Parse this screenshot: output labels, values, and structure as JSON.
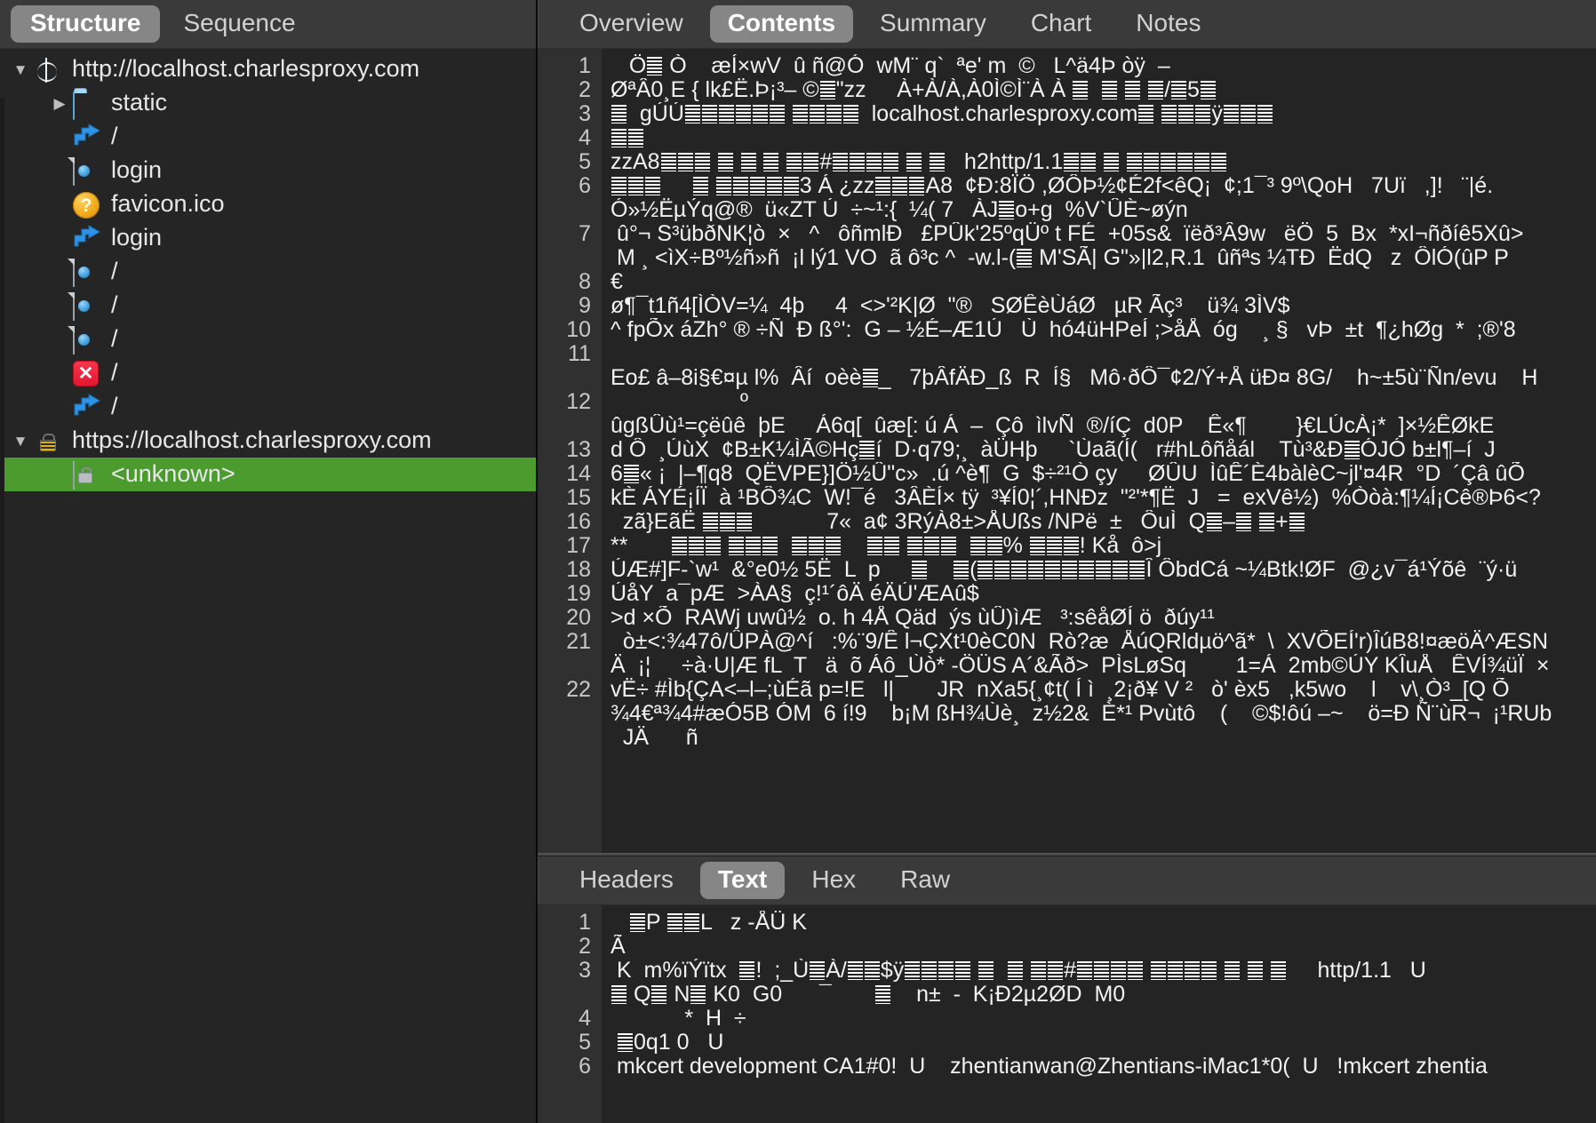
{
  "sidebar": {
    "tabs": [
      {
        "label": "Structure",
        "active": true
      },
      {
        "label": "Sequence",
        "active": false
      }
    ],
    "tree": [
      {
        "label": "http://localhost.charlesproxy.com",
        "icon": "globe-icon",
        "twisty": "open",
        "indent": 1,
        "selected": false
      },
      {
        "label": "static",
        "icon": "folder-icon",
        "twisty": "closed",
        "indent": 2,
        "selected": false
      },
      {
        "label": "/",
        "icon": "redirect-icon",
        "twisty": "blank",
        "indent": 2,
        "selected": false
      },
      {
        "label": "login",
        "icon": "document-icon",
        "twisty": "blank",
        "indent": 2,
        "selected": false
      },
      {
        "label": "favicon.ico",
        "icon": "question-icon",
        "twisty": "blank",
        "indent": 2,
        "selected": false
      },
      {
        "label": "login",
        "icon": "redirect-icon",
        "twisty": "blank",
        "indent": 2,
        "selected": false
      },
      {
        "label": "/",
        "icon": "document-icon",
        "twisty": "blank",
        "indent": 2,
        "selected": false
      },
      {
        "label": "/",
        "icon": "document-icon",
        "twisty": "blank",
        "indent": 2,
        "selected": false
      },
      {
        "label": "/",
        "icon": "document-icon",
        "twisty": "blank",
        "indent": 2,
        "selected": false
      },
      {
        "label": "/",
        "icon": "error-icon",
        "twisty": "blank",
        "indent": 2,
        "selected": false
      },
      {
        "label": "/",
        "icon": "redirect-icon",
        "twisty": "blank",
        "indent": 2,
        "selected": false
      },
      {
        "label": "https://localhost.charlesproxy.com",
        "icon": "lock-icon",
        "twisty": "open",
        "indent": 1,
        "selected": false
      },
      {
        "label": "<unknown>",
        "icon": "doc-lock-icon",
        "twisty": "blank",
        "indent": 2,
        "selected": true
      }
    ],
    "selected_color": "#4b9b2f"
  },
  "main_pane": {
    "tabs": [
      {
        "label": "Overview",
        "active": false
      },
      {
        "label": "Contents",
        "active": true
      },
      {
        "label": "Summary",
        "active": false
      },
      {
        "label": "Chart",
        "active": false
      },
      {
        "label": "Notes",
        "active": false
      }
    ],
    "line_numbers": [
      "1",
      "2",
      "3",
      "4",
      "5",
      "6",
      "",
      "7",
      "",
      "8",
      "9",
      "10",
      "11",
      "",
      "12",
      "",
      "13",
      "14",
      "15",
      "16",
      "17",
      "18",
      "19",
      "20",
      "21",
      "",
      "22",
      ""
    ],
    "lines": [
      "   Ö█ Ò    æÍ×wV  û ñ@Ó  wM¨ q`  ªe' m  ©   L^ä4Þ òÿ  –",
      "ØªÂ0¸E { lk£Ë.Þ¡³– ©█\"zz     À+À/À,À0Ì©Ì¨À À █  █ █ █/█5█",
      "█  gÚÚ██████ ████  localhost.charlesproxy.com█ ███ÿ███",
      "██",
      "zzA8███ █ █ █ ██#████ █ █   h2http/1.1██ █ ██████",
      "███     █ █████3 Á ¿zz███A8  ¢Ð:8ÏÖ ,ØÔÞ½¢É2f<êQ¡  ¢;1¯³ 9º\\QoH   7Uï   ,]!   ¨|é.",
      "Ó»½ËµÝq@®  ü«ZT Ú  ÷~¹:{  ¼( 7   ÀJ█o+g  %V`ÛÈ~øýn",
      " û°¬ S³übðNK¦ò  ×   ^   ôñmlÐ   £PÛk'25ºqÜº t FÉ  +05s&  ïëð³Â9w   ëÖ  5  Bx  *xI¬ñðíê5Xû>",
      " M ¸ <ìX÷Bº½ñ»ñ  ¡l lý1 VO  ã ô³c ^  -w.l-(█ M'SÃ| G\"»|l2,R.1  ûñªs ¼TÐ  ËdQ   z  ÔlÓ(ûP P",
      "€",
      "ø¶¯t1ñ4[ÌÒV=¼  4þ     4  <>'²K|Ø  \"®   SØÊèÙáØ   µR Ãç³    ü¾ 3ÌV$",
      "^ fpÕx áZh° ® ÷Ñ  Ð ß°':  G – ½É–Æ1Ú   Ù  hó4üHPeÍ ;>åÅ  óg    ¸ §   vÞ  ±t  ¶¿hØg  *  ;®'8",
      "",
      "Eo£ â–8i§€¤µ l%  Âí  oèè█_   7þÂfÄÐ_ß  R  Í§   Mô·ðÔ¯¢2/Ý+Å üÐ¤ 8G/    h~±5ù¨Ñn/evu    H",
      "                     º",
      "ûgßÛù¹=çëûê  þE     Á6q[  ûæ[: ú Á  –  Çô  ìlvÑ  ®/íÇ  d0P    Ê«¶        }€LÚcÀ¡*  ]×½ÊØkE",
      "d Ô  ¸ÚùX  ¢B±K¼ÌÃ©Hç█í  D·q79;¸  àÜHþ     `Ùaã(Í(   r#hLôñåál    Tù³&Ð█ÓJÓ b±l¶–í  J",
      "6█« ¡  |–¶q8  QËVPE}]Ö½Û\"c»  .ú ^è¶  G  $÷²¹Ò çy     ØÛU  ÌûÊ´È4bàlèC~jl'¤4R  °D  ´Çâ ûÕ",
      "kÈ ÁYÉ¡ÍÏ  à ¹BÔ¾C  W!¯é   3ÂÈÍ× tÿ  ³¥Í0¦´,HNÐz  \"²'*¶Ë  J   =  exVê½)  %Òòà:¶¼Í¡Cê®Þ6<?  ",
      "  zã}EãË ███            7«  a¢ 3RýÀ8±>ÅUßs /NPë  ±   ÔuÌ  Q█–█ █+█",
      "**       ███ ███  ███    ██ ███  ██% ███! Kå  ô>j",
      "ÚÆ#]F-`w¹  &°e0½ 5Ë  L  p     █    █(██████████Î ÔbdCá ~¼Btk!ØF  @¿v¯á¹Ýõê  ¨ý·ü",
      "ÚåY  a¯pÆ  >ÀA§  ç!¹´ôÄ éÄÚ'ÆAû$",
      ">d ×Õ  RAWj uwû½  o. h 4Å Qäd  ýs ùÛ)ìÆ   ³:sêåØÍ ö  ðúy¹¹",
      "  ò±<:¾47ô/ÛPÀ@^í   :%¨9/Ê l¬ÇXt¹0èC0N  Rò?æ  ÅúQRldµö^ã*  \\  XVÕEÍ'r)ÎúB8!¤æöÄ^ÆSN",
      "Ä  ¡¦     ÷à·U|Æ fL  T   ä  õ Áô_Ùò* -ÖÜS A´&Ãð>  PÌsLøSq        1=Á  2mb©ÚY KÎuÅ   ÊVÍ¾üÏ  ×",
      "vË÷ #Ìb{ÇA<–l–;ùÉã p=!E   l|       JR  nXa5{¸¢t( Í ì  ¸2¡ð¥ V ²   ò' èx5   ,k5wo    l    v\\¸Ò³_[Q Õ",
      "¾4€ª¾4#æÓ5B ÓM  6 í!9    b¡M ßH¾Ùè¸  z½2&  È*¹ Pvùtô    (    ©$!ôú –~    ö=Ð Ñ¨ùR¬  ¡¹RUb",
      "  JÄ      ñ"
    ]
  },
  "bottom_pane": {
    "tabs": [
      {
        "label": "Headers",
        "active": false
      },
      {
        "label": "Text",
        "active": true
      },
      {
        "label": "Hex",
        "active": false
      },
      {
        "label": "Raw",
        "active": false
      }
    ],
    "line_numbers": [
      "1",
      "2",
      "3",
      "",
      "4",
      "5",
      "6"
    ],
    "lines": [
      "   █P ██L   z -ÅÜ K",
      "Ã",
      " K  m%ïÝïtx  █!  ;_Ù█À/██$ÿ████ █  █ ██#████ ████ █ █ █     http/1.1   U",
      "█ Q█ N█ K0  G0      ¯       █    n±  -  K¡Ð2µ2ØD  M0",
      "            *  H  ÷",
      " █0q1 0   U",
      " mkcert development CA1#0!  U    zhentianwan@Zhentians-iMac1*0(  U   !mkcert zhentia"
    ]
  },
  "colors": {
    "window_bg": "#242424",
    "tabbar_bg": "#3a3a3a",
    "tab_active_bg": "#868686",
    "gutter_bg": "#303030",
    "code_bg": "#242424",
    "text": "#f2f2f2",
    "selection_green": "#4b9b2f"
  }
}
